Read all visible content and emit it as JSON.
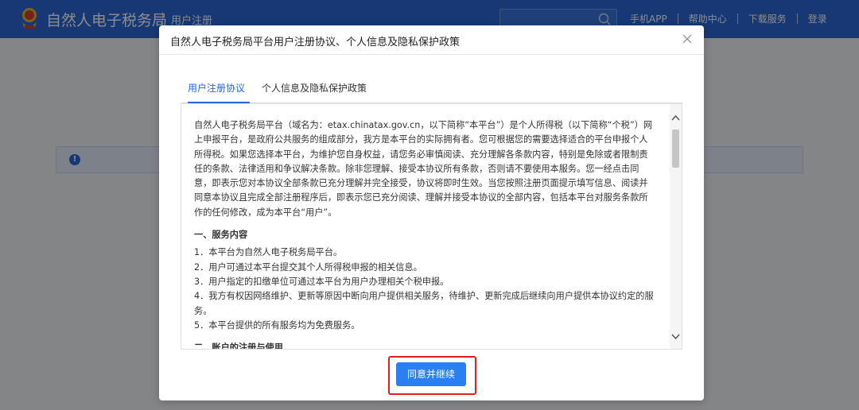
{
  "header": {
    "brand": "自然人电子税务局",
    "subtitle": "用户注册",
    "search_placeholder": "",
    "links": [
      "手机APP",
      "帮助中心",
      "下载服务",
      "登录"
    ],
    "bg_color": "#2a66d4"
  },
  "modal": {
    "title": "自然人电子税务局平台用户注册协议、个人信息及隐私保护政策",
    "tabs": [
      {
        "label": "用户注册协议",
        "active": true
      },
      {
        "label": "个人信息及隐私保护政策",
        "active": false
      }
    ],
    "intro": "自然人电子税务局平台（域名为：etax.chinatax.gov.cn，以下简称“本平台”）是个人所得税（以下简称“个税”）网上申报平台，是政府公共服务的组成部分，我方是本平台的实际拥有者。您可根据您的需要选择适合的平台申报个人所得税。如果您选择本平台，为维护您自身权益，请您务必审慎阅读、充分理解各条款内容，特别是免除或者限制责任的条款、法律适用和争议解决条款。除非您理解、接受本协议所有条款，否则请不要使用本服务。您一经点击同意，即表示您对本协议全部条款已充分理解并完全接受，协议将即时生效。当您按照注册页面提示填写信息、阅读并同意本协议且完成全部注册程序后，即表示您已充分阅读、理解并接受本协议的全部内容，包括本平台对服务条款所作的任何修改，成为本平台“用户”。",
    "section1_title": "一、服务内容",
    "section1_items": [
      "1．本平台为自然人电子税务局平台。",
      "2．用户可通过本平台提交其个人所得税申报的相关信息。",
      "3．用户指定的扣缴单位可通过本平台为用户办理相关个税申报。",
      "4．我方有权因网络维护、更新等原因中断向用户提供相关服务，待维护、更新完成后继续向用户提供本协议约定的服务。",
      "5．本平台提供的所有服务均为免费服务。"
    ],
    "section2_title": "二、账户的注册与使用",
    "agree_button": "同意并继续"
  }
}
